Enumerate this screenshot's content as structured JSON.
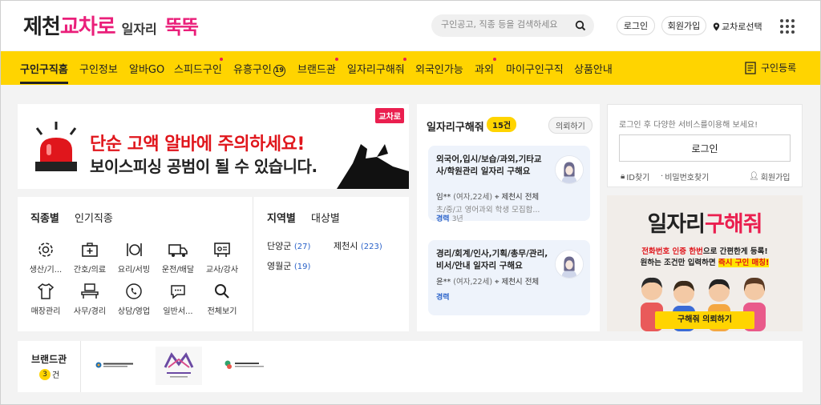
{
  "header": {
    "logo": {
      "part1": "제천",
      "part2": "교차로",
      "part3": "일자리",
      "part4": "뚝뚝"
    },
    "search_placeholder": "구인공고, 직종 등을 검색하세요",
    "login_label": "로그인",
    "signup_label": "회원가입",
    "region_label": "교차로선택"
  },
  "nav": {
    "items": [
      {
        "label": "구인구직홈"
      },
      {
        "label": "구인정보"
      },
      {
        "label": "알바GO"
      },
      {
        "label": "스피드구인"
      },
      {
        "label": "유흥구인",
        "badge": "19"
      },
      {
        "label": "브랜드관"
      },
      {
        "label": "일자리구해줘"
      },
      {
        "label": "외국인가능"
      },
      {
        "label": "과외"
      },
      {
        "label": "마이구인구직"
      },
      {
        "label": "상품안내"
      }
    ],
    "register_label": "구인등록"
  },
  "banner": {
    "tag": "교차로",
    "line1": "단순 고액 알바에 주의하세요!",
    "line2": "보이스피싱 공범이 될 수 있습니다."
  },
  "categories": {
    "tab_active": "직종별",
    "tab_other": "인기직종",
    "items": [
      {
        "label": "생산/기...",
        "icon": "gear-icon"
      },
      {
        "label": "간호/의료",
        "icon": "medical-kit-icon"
      },
      {
        "label": "요리/서빙",
        "icon": "dining-icon"
      },
      {
        "label": "운전/배달",
        "icon": "truck-icon"
      },
      {
        "label": "교사/강사",
        "icon": "teacher-icon"
      },
      {
        "label": "매장관리",
        "icon": "shirt-icon"
      },
      {
        "label": "사무/경리",
        "icon": "office-desk-icon"
      },
      {
        "label": "상담/영업",
        "icon": "phone-chat-icon"
      },
      {
        "label": "일반서...",
        "icon": "chat-bubble-icon"
      },
      {
        "label": "전체보기",
        "icon": "search-icon"
      }
    ]
  },
  "regions": {
    "tab_active": "지역별",
    "tab_other": "대상별",
    "items": [
      {
        "name": "단양군",
        "count": "(27)"
      },
      {
        "name": "제천시",
        "count": "(223)"
      },
      {
        "name": "영월군",
        "count": "(19)"
      }
    ]
  },
  "seekers": {
    "title": "일자리구해줘",
    "count": "15건",
    "request_label": "의뢰하기",
    "cards": [
      {
        "title": "외국어,입시/보습/과외,기타교사/학원관리 일자리 구해요",
        "name": "임**",
        "info": "(여자,22세)",
        "location": "제천시 전체",
        "desc": "초/중/고 영어과외 학생 모집합...",
        "exp_label": "경력",
        "exp_years": "3년"
      },
      {
        "title": "경리/회계/인사,기획/총무/관리,비서/안내 일자리 구해요",
        "name": "윤**",
        "info": "(여자,22세)",
        "location": "제천시 전체",
        "desc": "",
        "exp_label": "경력",
        "exp_years": ""
      }
    ]
  },
  "login_panel": {
    "message": "로그인 후 다양한 서비스를이용해 보세요!",
    "button": "로그인",
    "find_id": "ID찾기",
    "find_pw": "비밀번호찾기",
    "signup": "회원가입"
  },
  "ad": {
    "title_a": "일자리",
    "title_b": "구해줘",
    "sub1_red": "전화번호 인증 한번",
    "sub1_rest": "으로 간편한게 등록!",
    "sub2_rest": "원하는 조건만 입력하면 ",
    "sub2_red": "즉시 구인 매칭!",
    "cta": "구해줘 의뢰하기"
  },
  "brand": {
    "title": "브랜드관",
    "count": "3",
    "count_unit": "건",
    "logos": [
      "대명리조트 로고",
      "청풍 리조트 로고",
      "제천시 로고"
    ]
  },
  "colors": {
    "accent": "#ffd400",
    "brand_pink": "#ea1f7a",
    "link_blue": "#2a62c9",
    "alert_red": "#e0161c"
  }
}
